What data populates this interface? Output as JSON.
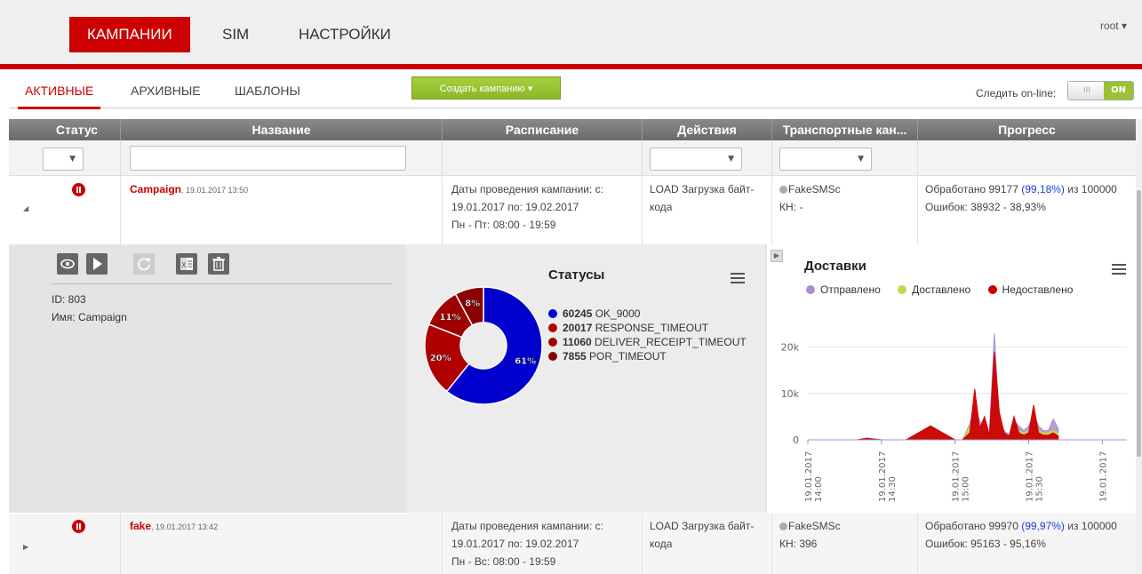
{
  "topnav": {
    "items": [
      {
        "label": "КАМПАНИИ",
        "active": true
      },
      {
        "label": "SIM",
        "active": false
      },
      {
        "label": "НАСТРОЙКИ",
        "active": false
      }
    ],
    "user": "root ▾"
  },
  "subnav": {
    "tabs": [
      {
        "label": "АКТИВНЫЕ",
        "active": true
      },
      {
        "label": "АРХИВНЫЕ",
        "active": false
      },
      {
        "label": "ШАБЛОНЫ",
        "active": false
      }
    ],
    "create_button": "Создать кампанию ▾",
    "follow_label": "Следить on-line:",
    "toggle_off": "III",
    "toggle_on": "ON"
  },
  "table": {
    "columns": [
      "Статус",
      "Название",
      "Расписание",
      "Действия",
      "Транспортные кан...",
      "Прогресс"
    ],
    "rows": [
      {
        "name": "Campaign",
        "created": ", 19.01.2017 13:50",
        "schedule_1": "Даты проведения кампании: с:",
        "schedule_2": "19.01.2017 по: 19.02.2017",
        "schedule_3": "Пн - Пт: 08:00 - 19:59",
        "action_1": "LOAD Загрузка байт-",
        "action_2": "кода",
        "transport": "FakeSMSc",
        "kn": "КН: -",
        "progress_prefix": "Обработано 99177 ",
        "progress_pct": "(99,18%)",
        "progress_suffix": " из 100000",
        "errors": "Ошибок: 38932 - 38,93%"
      },
      {
        "name": "fake",
        "created": ", 19.01.2017 13:42",
        "schedule_1": "Даты проведения кампании: с:",
        "schedule_2": "19.01.2017 по: 19.02.2017",
        "schedule_3": "Пн - Вс: 08:00 - 19:59",
        "action_1": "LOAD Загрузка байт-",
        "action_2": "кода",
        "transport": "FakeSMSc",
        "kn": "КН: 396",
        "progress_prefix": "Обработано 99970 ",
        "progress_pct": "(99,97%)",
        "progress_suffix": " из 100000",
        "errors": "Ошибок: 95163 - 95,16%"
      }
    ]
  },
  "detail": {
    "id_line": "ID: 803",
    "name_line": "Имя: Campaign",
    "toolbar_icons": [
      "eye-icon",
      "play-icon",
      "refresh-icon",
      "excel-icon",
      "trash-icon"
    ]
  },
  "colors": {
    "brand_red": "#cc0000",
    "ok": "#0000cc",
    "response_timeout": "#b00000",
    "deliver_timeout": "#a00000",
    "por_timeout": "#8b0000",
    "sent": "#a98fcf",
    "delivered": "#c5d94a",
    "undelivered": "#cc0000"
  },
  "chart_data": [
    {
      "type": "pie",
      "title": "Статусы",
      "slices": [
        {
          "value": 60245,
          "label": "OK_9000",
          "pct": "61%",
          "color": "#0000cc"
        },
        {
          "value": 20017,
          "label": "RESPONSE_TIMEOUT",
          "pct": "20%",
          "color": "#b00000"
        },
        {
          "value": 11060,
          "label": "DELIVER_RECEIPT_TIMEOUT",
          "pct": "11%",
          "color": "#a00000"
        },
        {
          "value": 7855,
          "label": "POR_TIMEOUT",
          "pct": "8%",
          "color": "#8b0000"
        }
      ]
    },
    {
      "type": "area",
      "title": "Доставки",
      "legend": [
        "Отправлено",
        "Доставлено",
        "Недоставлено"
      ],
      "yticks": [
        "0",
        "10k",
        "20k"
      ],
      "ylim": [
        0,
        28000
      ],
      "xticks": [
        "19.01.2017 14:00",
        "19.01.2017 14:30",
        "19.01.2017 15:00",
        "19.01.2017 15:30",
        "19.01.2017"
      ],
      "x_minutes": [
        0,
        20,
        24,
        30,
        40,
        50,
        60,
        62,
        63,
        66,
        68,
        70,
        72,
        74,
        76,
        78,
        80,
        82,
        84,
        86,
        88,
        90,
        92,
        94,
        96,
        98,
        100,
        102
      ],
      "series": [
        {
          "name": "Отправлено",
          "values": [
            0,
            0,
            400,
            0,
            0,
            3000,
            0,
            0,
            0,
            3500,
            7500,
            4000,
            1500,
            1500,
            23000,
            4000,
            2000,
            1000,
            4000,
            3000,
            2000,
            3000,
            5500,
            3000,
            2000,
            2000,
            4500,
            2500
          ]
        },
        {
          "name": "Доставлено",
          "values": [
            0,
            0,
            300,
            0,
            0,
            2500,
            0,
            0,
            0,
            3000,
            5000,
            3000,
            1000,
            1000,
            7000,
            3000,
            1500,
            800,
            3000,
            2000,
            1500,
            2000,
            3000,
            2000,
            1500,
            1500,
            2000,
            1500
          ]
        },
        {
          "name": "Недоставлено",
          "values": [
            0,
            0,
            300,
            0,
            0,
            3000,
            0,
            0,
            0,
            1500,
            11000,
            2500,
            5000,
            1000,
            19000,
            6000,
            1500,
            800,
            5000,
            1500,
            1000,
            1500,
            7500,
            1500,
            1000,
            1000,
            1500,
            800
          ]
        }
      ]
    }
  ]
}
